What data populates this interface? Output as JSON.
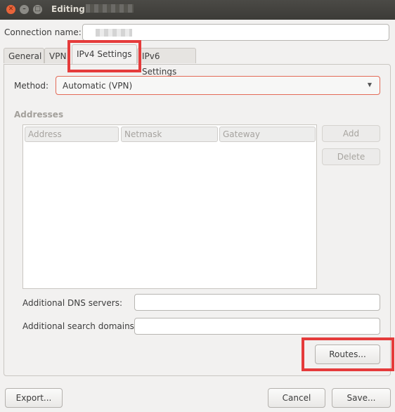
{
  "window": {
    "title": "Editing"
  },
  "connection": {
    "label": "Connection name:",
    "value": ""
  },
  "tabs": [
    {
      "label": "General"
    },
    {
      "label": "VPN"
    },
    {
      "label": "IPv4 Settings"
    },
    {
      "label": "IPv6 Settings"
    }
  ],
  "method": {
    "label": "Method:",
    "value": "Automatic (VPN)"
  },
  "addresses": {
    "heading": "Addresses",
    "columns": [
      "Address",
      "Netmask",
      "Gateway"
    ],
    "add_label": "Add",
    "delete_label": "Delete"
  },
  "dns": {
    "label": "Additional DNS servers:",
    "value": ""
  },
  "search_domains": {
    "label": "Additional search domains:",
    "value": ""
  },
  "routes_label": "Routes...",
  "footer": {
    "export_label": "Export...",
    "cancel_label": "Cancel",
    "save_label": "Save..."
  },
  "colors": {
    "highlight": "#e53b3b",
    "titlebar": "#3c3b37",
    "close_button": "#e9643a"
  }
}
